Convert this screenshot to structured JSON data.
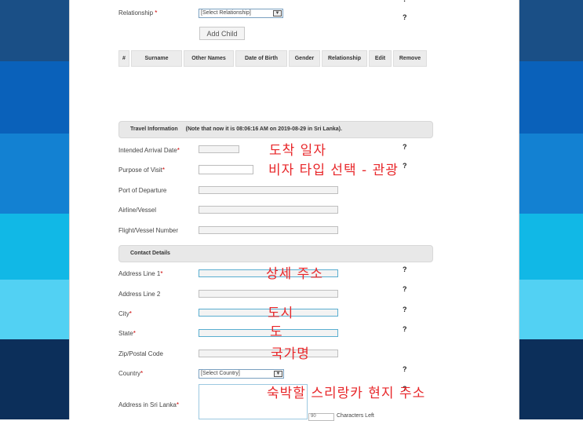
{
  "child": {
    "relationship_label": "Relationship",
    "relationship_required": "*",
    "relationship_value": "[Select Relationship]",
    "help": "?",
    "add_child_label": "Add Child",
    "table_headers": [
      "#",
      "Surname",
      "Other Names",
      "Date of Birth",
      "Gender",
      "Relationship",
      "Edit",
      "Remove"
    ]
  },
  "travel": {
    "section_title": "Travel Information",
    "note": "(Note that now it is 08:06:16 AM on 2019-08-29 in Sri Lanka).",
    "fields": [
      {
        "label": "Intended Arrival Date",
        "required": "*",
        "help": "?"
      },
      {
        "label": "Purpose of Visit",
        "required": "*",
        "help": "?"
      },
      {
        "label": "Port of Departure",
        "required": "",
        "help": ""
      },
      {
        "label": "Airline/Vessel",
        "required": "",
        "help": ""
      },
      {
        "label": "Flight/Vessel Number",
        "required": "",
        "help": ""
      }
    ]
  },
  "contact": {
    "section_title": "Contact Details",
    "fields": [
      {
        "label": "Address Line 1",
        "required": "*",
        "help": "?"
      },
      {
        "label": "Address Line 2",
        "required": "",
        "help": "?"
      },
      {
        "label": "City",
        "required": "*",
        "help": "?"
      },
      {
        "label": "State",
        "required": "*",
        "help": "?"
      },
      {
        "label": "Zip/Postal Code",
        "required": "",
        "help": ""
      }
    ],
    "country_label": "Country",
    "country_required": "*",
    "country_value": "[Select Country]",
    "country_help": "?",
    "sl_address_label": "Address in Sri Lanka",
    "sl_address_required": "*",
    "sl_address_help": "?",
    "chars_count": "90",
    "chars_left_label": "Characters Left"
  },
  "annotations": {
    "arrival_date": "도착 일자",
    "visa_type": "비자 타입 선택 - 관광",
    "address_detail": "상세 주소",
    "city": "도시",
    "state": "도",
    "country_name": "국가명",
    "sri_lanka_address": "숙박할 스리랑카 현지 주소"
  },
  "colors": {
    "annotation": "#e8272a",
    "side_bands": [
      "#1a4f86",
      "#0a61ba",
      "#1381d2",
      "#11b8e6",
      "#52d1f3",
      "#0c2f5a"
    ]
  }
}
